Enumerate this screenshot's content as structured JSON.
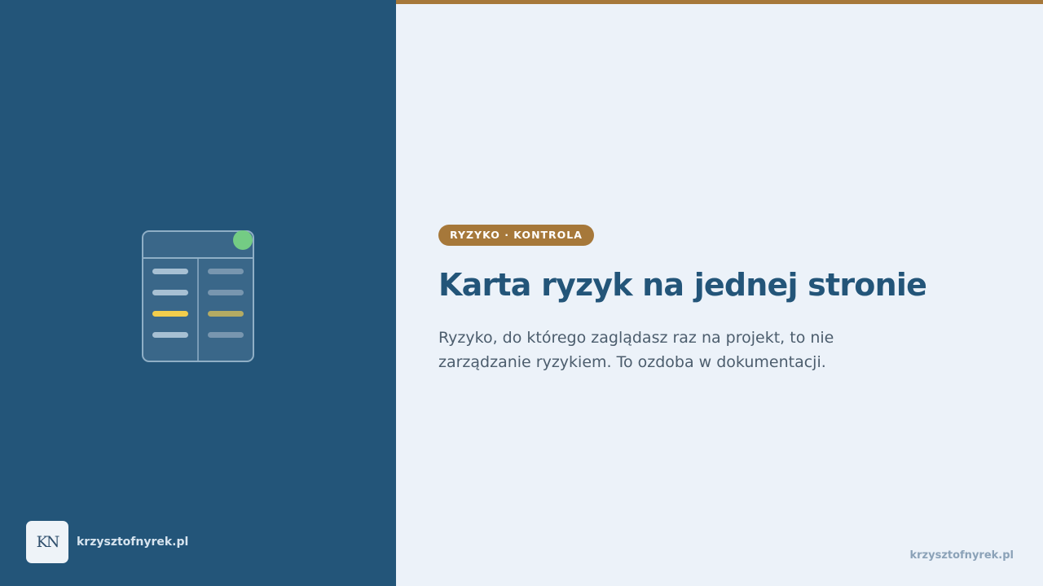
{
  "brand": {
    "logo_text": "KN",
    "name": "krzysztofnyrek.pl"
  },
  "content": {
    "tag": "RYZYKO · KONTROLA",
    "title": "Karta ryzyk na jednej stronie",
    "subtitle": "Ryzyko, do którego zaglądasz raz na projekt, to nie zarządzanie ryzykiem. To ozdoba w dokumentacji."
  },
  "footer": {
    "link": "krzysztofnyrek.pl"
  },
  "illustration": {
    "icon": "risk-table-icon",
    "status_dot_color": "#74cc84",
    "highlight_color": "#f2cd4c"
  },
  "colors": {
    "left_panel": "#235579",
    "right_panel": "#ecf2f9",
    "accent": "#a6783a",
    "title": "#235579"
  }
}
